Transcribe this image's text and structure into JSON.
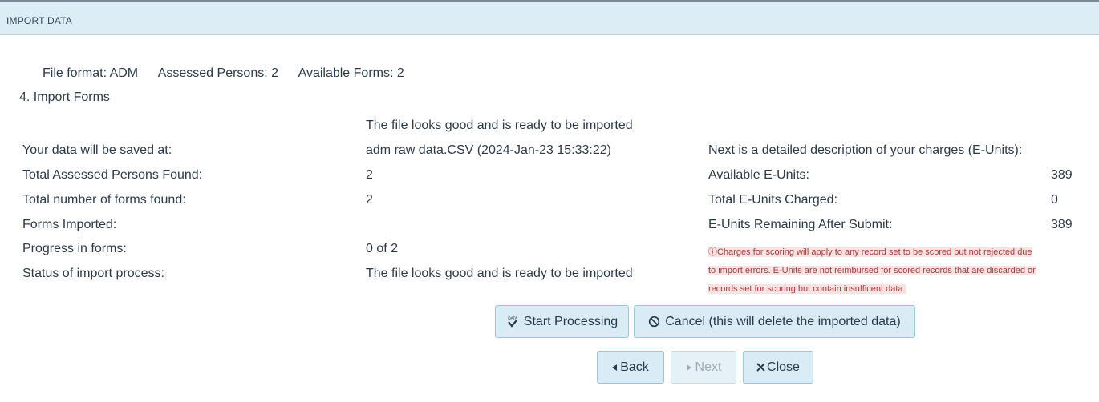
{
  "header": {
    "title": "IMPORT DATA"
  },
  "summary": {
    "file_format": "File format: ADM",
    "assessed_persons": "Assessed Persons: 2",
    "available_forms": "Available Forms: 2"
  },
  "step_title": "4. Import Forms",
  "status_banner": "The file looks good and is ready to be imported",
  "details": [
    {
      "label": "Your data will be saved at:",
      "value": "adm raw data.CSV (2024-Jan-23 15:33:22)"
    },
    {
      "label": "Total Assessed Persons Found:",
      "value": "2"
    },
    {
      "label": "Total number of forms found:",
      "value": "2"
    },
    {
      "label": "Forms Imported:",
      "value": ""
    },
    {
      "label": "Progress in forms:",
      "value": "0 of 2"
    },
    {
      "label": "Status of import process:",
      "value": "The file looks good and is ready to be imported"
    }
  ],
  "charges": {
    "heading": "Next is a detailed description of your charges (E-Units):",
    "rows": [
      {
        "label": "Available E-Units:",
        "value": "389"
      },
      {
        "label": "Total E-Units Charged:",
        "value": "0"
      },
      {
        "label": "E-Units Remaining After Submit:",
        "value": "389"
      }
    ],
    "warning_lines": [
      "ⓘCharges for scoring will apply to any record set to be scored but not rejected due",
      "to import errors. E-Units are not reimbursed for scored records that are discarded or",
      "records set for scoring but contain insufficent data."
    ]
  },
  "buttons": {
    "start": "Start Processing",
    "cancel": "Cancel (this will delete the imported data)",
    "back": "Back",
    "next": "Next",
    "close": "Close"
  },
  "icons": {
    "start": "data-check-icon",
    "cancel": "ban-icon",
    "back": "triangle-left-icon",
    "next": "triangle-right-icon",
    "close": "x-icon"
  },
  "colors": {
    "header_bg": "#dcedf6",
    "button_bg": "#d9ecf6",
    "warning_text": "#a53c3c",
    "warning_bg": "#f8e2e2"
  }
}
